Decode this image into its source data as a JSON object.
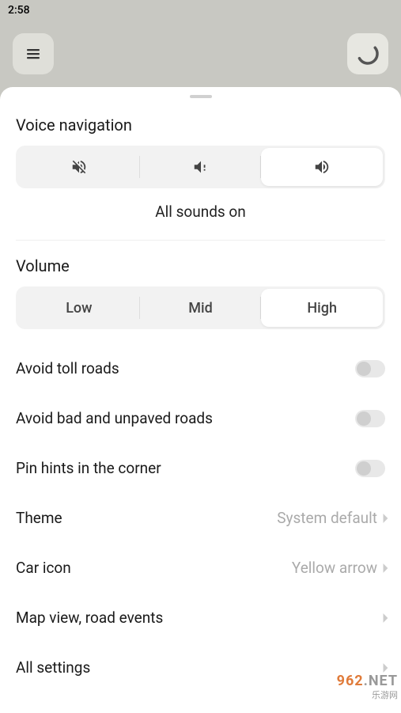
{
  "status_bar": {
    "time": "2:58"
  },
  "voice_nav": {
    "title": "Voice navigation",
    "options": [
      "mute",
      "alerts",
      "all"
    ],
    "selected": 2,
    "status": "All sounds on"
  },
  "volume": {
    "title": "Volume",
    "options": [
      "Low",
      "Mid",
      "High"
    ],
    "selected": 2
  },
  "toggles": [
    {
      "label": "Avoid toll roads",
      "on": false
    },
    {
      "label": "Avoid bad and unpaved roads",
      "on": false
    },
    {
      "label": "Pin hints in the corner",
      "on": false
    }
  ],
  "nav_items": [
    {
      "label": "Theme",
      "value": "System default"
    },
    {
      "label": "Car icon",
      "value": "Yellow arrow"
    },
    {
      "label": "Map view, road events",
      "value": ""
    },
    {
      "label": "All settings",
      "value": ""
    }
  ],
  "watermark": {
    "line1": "962.NET",
    "line2": "乐游网"
  }
}
